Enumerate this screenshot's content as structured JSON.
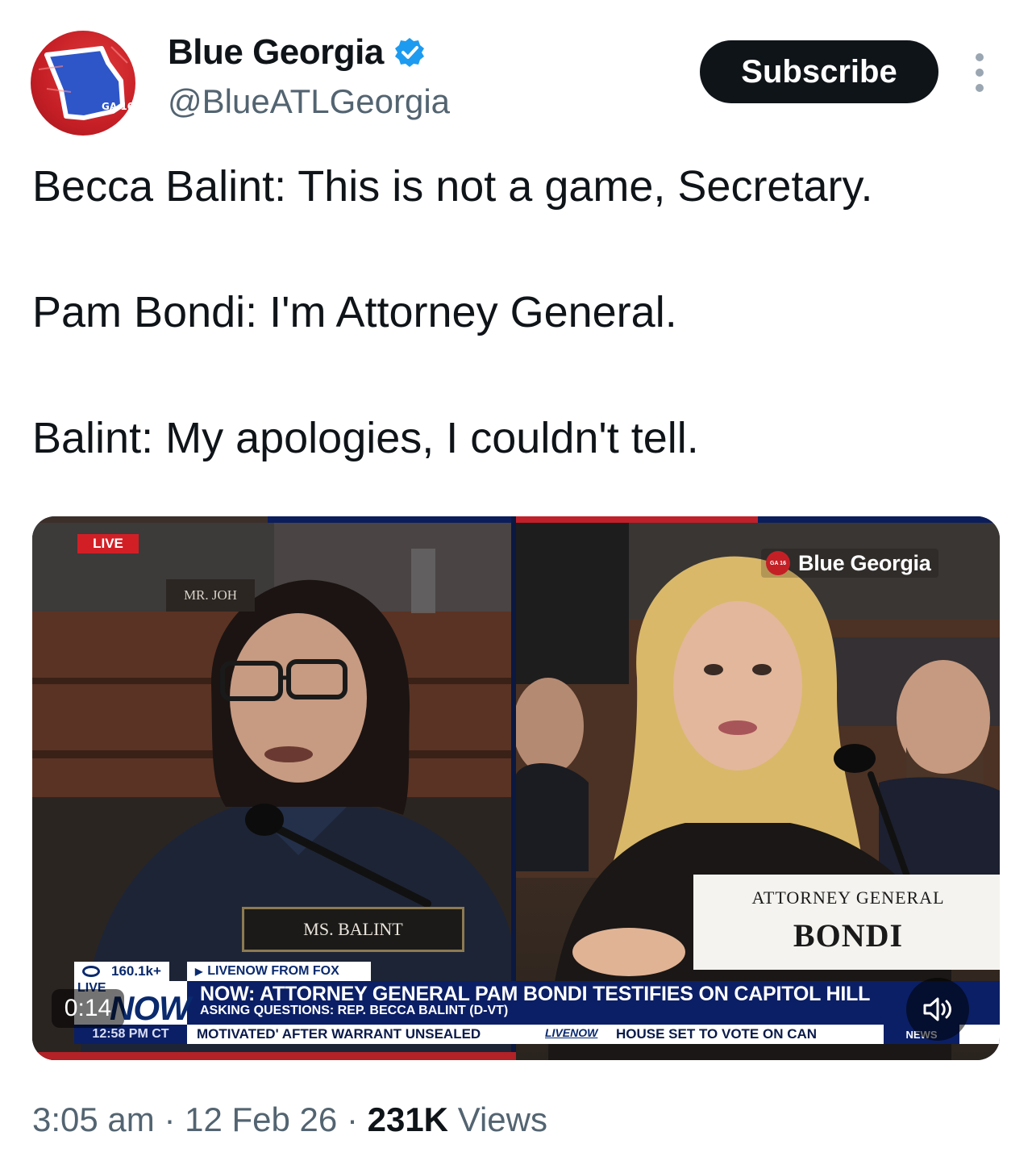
{
  "author": {
    "display_name": "Blue Georgia",
    "handle": "@BlueATLGeorgia",
    "avatar_label": "GA 16",
    "verified": true
  },
  "actions": {
    "subscribe_label": "Subscribe",
    "more_icon": "more-vertical-icon"
  },
  "tweet": {
    "lines": [
      "Becca Balint: This is not a game, Secretary.",
      "Pam Bondi: I'm Attorney General.",
      "Balint: My apologies, I couldn't tell."
    ]
  },
  "video": {
    "left_badge": "LIVE",
    "back_nameplate": "MR. JOH",
    "front_nameplate": "MS. BALINT",
    "ag_card_title": "ATTORNEY GENERAL",
    "ag_card_name": "BONDI",
    "watermark_text": "Blue Georgia",
    "watermark_logo": "GA 16",
    "views": "160.1k+",
    "livenow_label": "LIVENOW FROM FOX",
    "nowbox_live": "LIVE",
    "nowbox_now": "NOW",
    "headline": "NOW: ATTORNEY GENERAL PAM BONDI TESTIFIES ON CAPITOL HILL",
    "subhead": "ASKING QUESTIONS: REP. BECCA BALINT (D-VT)",
    "ticker_time": "12:58 PM CT",
    "ticker_1": "MOTIVATED' AFTER WARRANT UNSEALED",
    "ticker_logo": "LIVENOW",
    "ticker_2": "HOUSE SET TO VOTE ON CAN",
    "news_label": "NEWS",
    "elapsed": "0:14",
    "volume_icon": "speaker-icon"
  },
  "meta": {
    "time": "3:05 am",
    "date": "12 Feb 26",
    "views_count": "231K",
    "views_label": "Views",
    "separator": "·"
  },
  "colors": {
    "accent": "#0f1419",
    "verified": "#1d9bf0",
    "muted": "#536471",
    "fox_blue": "#0b1f66",
    "avatar_red": "#c51f26"
  }
}
